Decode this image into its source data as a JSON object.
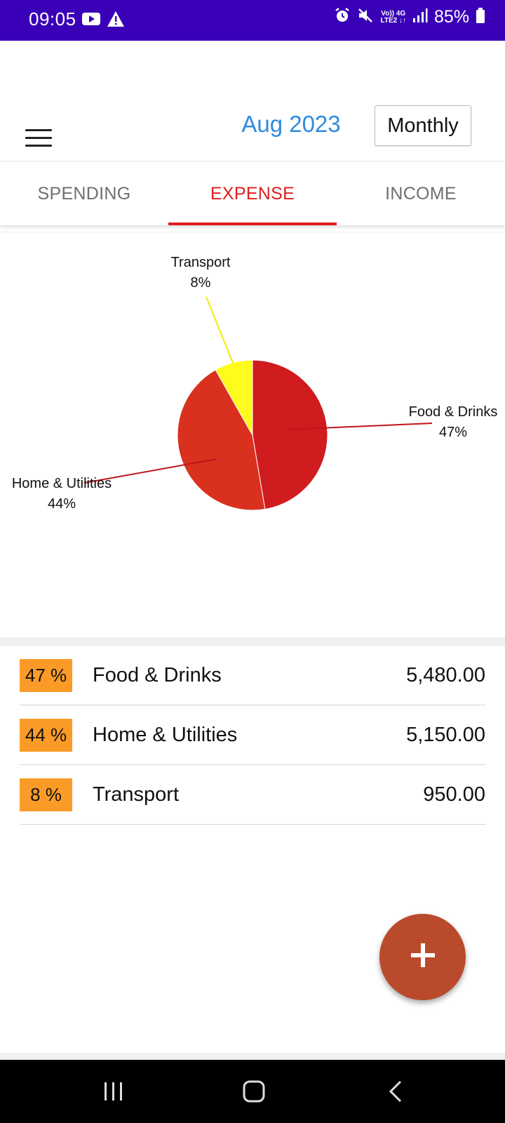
{
  "status_bar": {
    "time": "09:05",
    "battery": "85%",
    "net_top": "Vo)) 4G",
    "net_bottom": "LTE2 ↓↑",
    "icons": [
      "youtube-icon",
      "warning-icon",
      "alarm-icon",
      "mute-icon",
      "signal-icon",
      "battery-icon"
    ]
  },
  "header": {
    "month": "Aug 2023",
    "period": "Monthly"
  },
  "tabs": [
    {
      "label": "SPENDING",
      "active": false
    },
    {
      "label": "EXPENSE",
      "active": true
    },
    {
      "label": "INCOME",
      "active": false
    }
  ],
  "colors": {
    "status_bar": "#3a00b8",
    "accent_blue": "#2e8be0",
    "active_tab": "#e01e1e",
    "badge": "#fb9b27",
    "fab": "#b94a2c"
  },
  "chart_data": {
    "type": "pie",
    "slices": [
      {
        "label": "Food & Drinks",
        "percent_label": "47%",
        "value": 5480,
        "color": "#d01b1f"
      },
      {
        "label": "Home & Utilities",
        "percent_label": "44%",
        "value": 5150,
        "color": "#d9311e"
      },
      {
        "label": "Transport",
        "percent_label": "8%",
        "value": 950,
        "color": "#fffb1c"
      }
    ]
  },
  "list": {
    "items": [
      {
        "percent": "47 %",
        "name": "Food & Drinks",
        "amount": "5,480.00"
      },
      {
        "percent": "44 %",
        "name": "Home & Utilities",
        "amount": "5,150.00"
      },
      {
        "percent": "8 %",
        "name": "Transport",
        "amount": "950.00"
      }
    ]
  },
  "fab": {
    "icon": "plus-icon"
  },
  "nav": {
    "icons": [
      "recent-apps-icon",
      "home-icon",
      "back-icon"
    ]
  }
}
